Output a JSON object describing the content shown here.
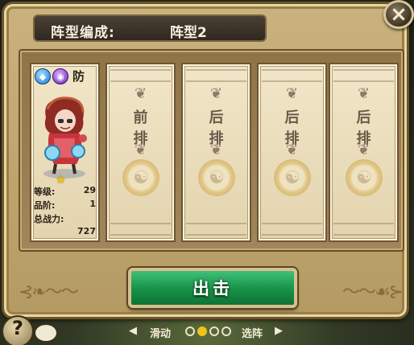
{
  "header": {
    "label": "阵型编成:",
    "formation_name": "阵型2"
  },
  "close": {
    "glyph": "×"
  },
  "hero": {
    "element_water_icon": "water-drop-icon",
    "element_dark_icon": "dark-swirl-icon",
    "role": "防",
    "stars": "★",
    "level_label": "等级:",
    "level_value": "29",
    "rank_label": "品阶:",
    "rank_value": "1",
    "power_label": "总战力:",
    "power_value": "727"
  },
  "slots": [
    {
      "line1": "前",
      "line2": "排"
    },
    {
      "line1": "后",
      "line2": "排"
    },
    {
      "line1": "后",
      "line2": "排"
    },
    {
      "line1": "后",
      "line2": "排"
    }
  ],
  "dispatch_label": "出击",
  "pager": {
    "prev_label": "滑动",
    "next_label": "选阵",
    "total_pages": 4,
    "current_page": 2
  },
  "help": {
    "glyph": "?"
  },
  "colors": {
    "dispatch": "#169146",
    "frame": "#b49a62",
    "title_bar": "#2f2820",
    "active_dot": "#f0c21e"
  }
}
